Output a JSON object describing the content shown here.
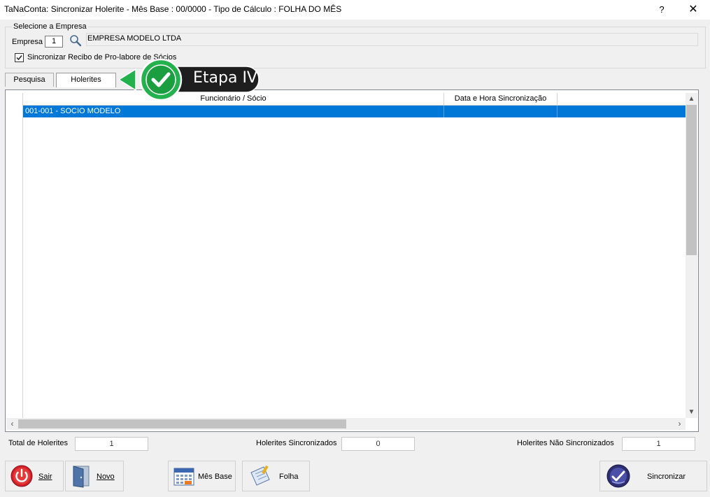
{
  "window": {
    "title": "TaNaConta: Sincronizar Holerite - Mês Base : 00/0000 - Tipo de Cálculo : FOLHA DO MÊS",
    "help_label": "?",
    "close_label": "✕"
  },
  "empresa": {
    "legend": "Selecione a Empresa",
    "label": "Empresa",
    "code": "1",
    "name": "EMPRESA MODELO LTDA",
    "checkbox_label": "Sincronizar Recibo de Pro-labore de Sócios",
    "checkbox_checked": true
  },
  "tabs": [
    {
      "label": "Pesquisa"
    },
    {
      "label": "Holerites"
    }
  ],
  "grid": {
    "columns": [
      "Funcionário / Sócio",
      "Data e Hora Sincronização"
    ],
    "rows": [
      [
        "001-001 - SOCIO MODELO",
        ""
      ]
    ],
    "selected_row": 0
  },
  "totals": {
    "total_label": "Total de Holerites",
    "total_value": "1",
    "sinc_label": "Holerites Sincronizados",
    "sinc_value": "0",
    "nao_label": "Holerites Não Sincronizados",
    "nao_value": "1"
  },
  "buttons": {
    "sair": "Sair",
    "novo": "Novo",
    "mes_base": "Mês Base",
    "folha": "Folha",
    "sincronizar": "Sincronizar"
  },
  "callout": {
    "text": "Etapa IV"
  },
  "colors": {
    "selection": "#0078d7",
    "callout_green": "#22b14c",
    "callout_dark": "#1e1e1e"
  }
}
